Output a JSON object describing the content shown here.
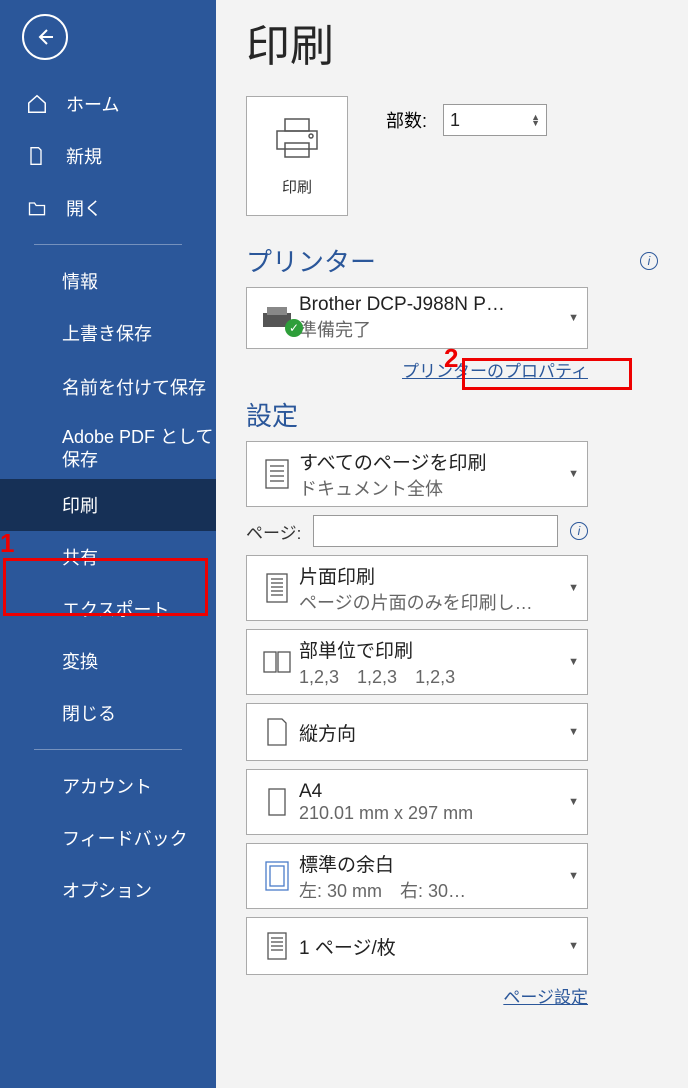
{
  "sidebar": {
    "home": "ホーム",
    "new": "新規",
    "open": "開く",
    "info": "情報",
    "save": "上書き保存",
    "saveas": "名前を付けて保存",
    "pdf": "Adobe PDF として保存",
    "print": "印刷",
    "share": "共有",
    "export": "エクスポート",
    "transform": "変換",
    "close": "閉じる",
    "account": "アカウント",
    "feedback": "フィードバック",
    "options": "オプション"
  },
  "title": "印刷",
  "print_button": "印刷",
  "copies_label": "部数:",
  "copies_value": "1",
  "printer_section": "プリンター",
  "printer": {
    "name": "Brother DCP-J988N P…",
    "status": "準備完了"
  },
  "printer_props": "プリンターのプロパティ",
  "settings_section": "設定",
  "dd_pages": {
    "t": "すべてのページを印刷",
    "s": "ドキュメント全体"
  },
  "pages_label": "ページ:",
  "pages_value": "",
  "dd_sides": {
    "t": "片面印刷",
    "s": "ページの片面のみを印刷し…"
  },
  "dd_collate": {
    "t": "部単位で印刷",
    "s": "1,2,3　1,2,3　1,2,3"
  },
  "dd_orient": {
    "t": "縦方向",
    "s": ""
  },
  "dd_paper": {
    "t": "A4",
    "s": "210.01 mm x 297 mm"
  },
  "dd_margin": {
    "t": "標準の余白",
    "s": "左: 30 mm　右: 30…"
  },
  "dd_ppsheet": {
    "t": "1 ページ/枚",
    "s": ""
  },
  "page_setup": "ページ設定",
  "anno": {
    "n1": "1",
    "n2": "2"
  }
}
